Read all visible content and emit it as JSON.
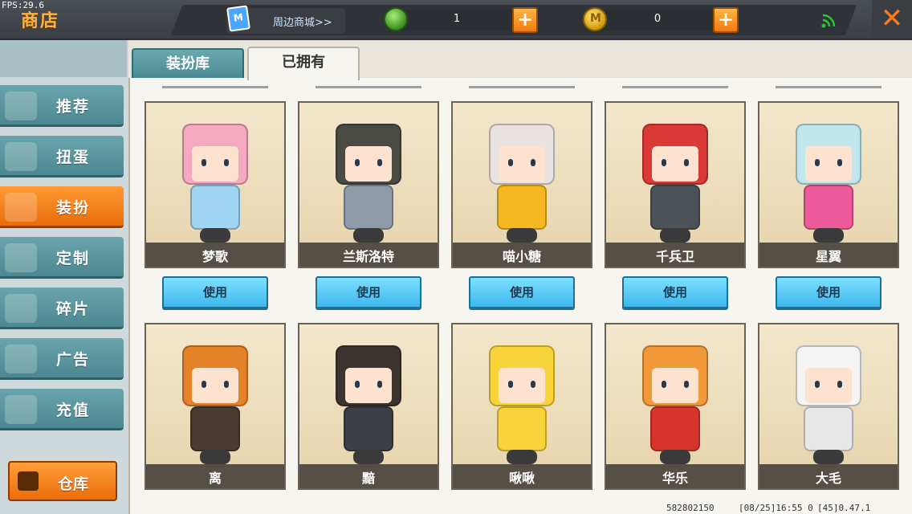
{
  "fps": "FPS:29.6",
  "header": {
    "title": "商店",
    "shop_link": "周边商城>>",
    "shop_bag_letter": "M",
    "gems": "1",
    "coins": "0",
    "coin_letter": "M",
    "plus": "+",
    "close": "✕"
  },
  "sidebar": {
    "items": [
      {
        "label": "推荐",
        "icon": "thumbs-up-icon",
        "active": false
      },
      {
        "label": "扭蛋",
        "icon": "capsule-icon",
        "active": false
      },
      {
        "label": "装扮",
        "icon": "outfit-icon",
        "active": true
      },
      {
        "label": "定制",
        "icon": "pencil-icon",
        "active": false
      },
      {
        "label": "碎片",
        "icon": "puzzle-icon",
        "active": false
      },
      {
        "label": "广告",
        "icon": "video-icon",
        "active": false
      },
      {
        "label": "充值",
        "icon": "coin-stack-icon",
        "active": false
      }
    ],
    "warehouse_label": "仓库"
  },
  "tabs": [
    {
      "label": "装扮库",
      "active": false
    },
    {
      "label": "已拥有",
      "active": true
    }
  ],
  "skins": [
    {
      "name": "梦歌",
      "button": "使用",
      "hair": "#f4a9c0",
      "outfit": "#9fd4f2"
    },
    {
      "name": "兰斯洛特",
      "button": "使用",
      "hair": "#4a4a45",
      "outfit": "#8e9aa8"
    },
    {
      "name": "喵小糖",
      "button": "使用",
      "hair": "#e8e2e0",
      "outfit": "#f6b820"
    },
    {
      "name": "千兵卫",
      "button": "使用",
      "hair": "#d93a36",
      "outfit": "#4b5359"
    },
    {
      "name": "星翼",
      "button": "使用",
      "hair": "#bfe6ec",
      "outfit": "#ec5a9a"
    },
    {
      "name": "离",
      "button": "",
      "hair": "#e4822a",
      "outfit": "#4a3a30"
    },
    {
      "name": "黯",
      "button": "",
      "hair": "#3b3330",
      "outfit": "#3c3f46"
    },
    {
      "name": "啾啾",
      "button": "",
      "hair": "#f8d43a",
      "outfit": "#f8d43a"
    },
    {
      "name": "华乐",
      "button": "",
      "hair": "#f29a3a",
      "outfit": "#d8342e"
    },
    {
      "name": "大毛",
      "button": "",
      "hair": "#f4f4f4",
      "outfit": "#e8e8e8"
    }
  ],
  "footer": {
    "id": "582802150",
    "time": "[08/25]16:55 0",
    "version": "[45]0.47.1"
  }
}
